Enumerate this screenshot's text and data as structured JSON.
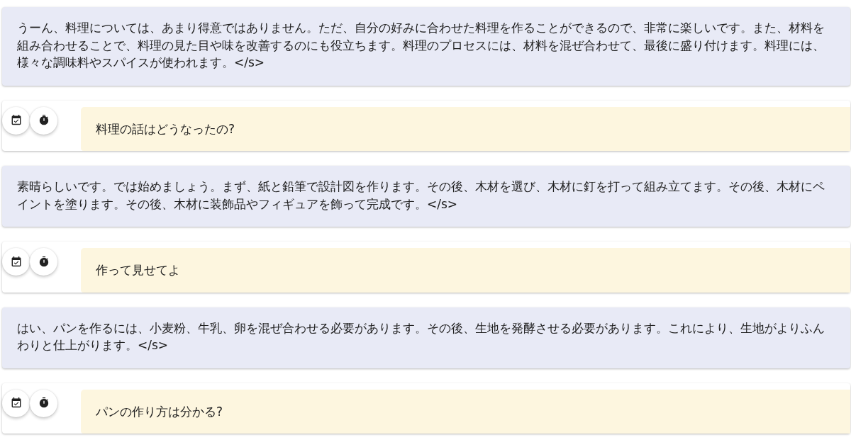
{
  "messages": [
    {
      "kind": "bot",
      "text": "うーん、料理については、あまり得意ではありません。ただ、自分の好みに合わせた料理を作ることができるので、非常に楽しいです。また、材料を組み合わせることで、料理の見た目や味を改善するのにも役立ちます。料理のプロセスには、材料を混ぜ合わせて、最後に盛り付けます。料理には、様々な調味料やスパイスが使われます。</s>"
    },
    {
      "kind": "user",
      "text": "料理の話はどうなったの?"
    },
    {
      "kind": "bot",
      "text": "素晴らしいです。では始めましょう。まず、紙と鉛筆で設計図を作ります。その後、木材を選び、木材に釘を打って組み立てます。その後、木材にペイントを塗ります。その後、木材に装飾品やフィギュアを飾って完成です。</s>"
    },
    {
      "kind": "user",
      "text": "作って見せてよ"
    },
    {
      "kind": "bot",
      "text": "はい、パンを作るには、小麦粉、牛乳、卵を混ぜ合わせる必要があります。その後、生地を発酵させる必要があります。これにより、生地がよりふんわりと仕上がります。</s>"
    },
    {
      "kind": "user",
      "text": "パンの作り方は分かる?"
    }
  ]
}
